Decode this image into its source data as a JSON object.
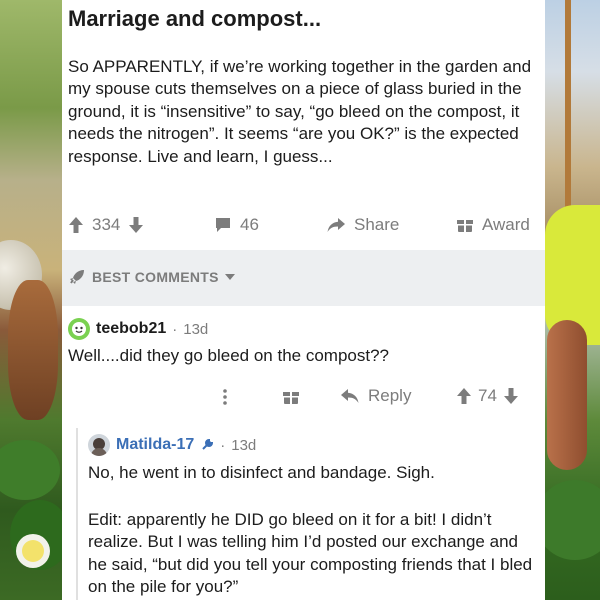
{
  "post": {
    "title": "Marriage and compost...",
    "body": "So APPARENTLY, if we’re working together in the garden and my spouse cuts themselves on a piece of glass buried in the ground, it is “insensitive” to say, “go bleed on the compost, it needs the nitrogen”.  It seems “are you OK?” is the expected response.  Live and learn, I guess...",
    "upvotes": "334",
    "comments": "46",
    "share_label": "Share",
    "award_label": "Award"
  },
  "sort": {
    "label": "BEST COMMENTS"
  },
  "comment1": {
    "author": "teebob21",
    "separator": "·",
    "age": "13d",
    "text": "Well....did they go bleed on the compost??",
    "reply_label": "Reply",
    "score": "74"
  },
  "comment2": {
    "author": "Matilda-17",
    "separator": "·",
    "age": "13d",
    "text": "No, he went in to disinfect and bandage. Sigh.",
    "edit": "Edit: apparently he DID go bleed on it for a bit! I didn’t realize. But I was telling him I’d posted our exchange and he said, “but did you tell your composting friends that I bled on the pile for you?”"
  },
  "colors": {
    "text": "#1c1c1c",
    "muted": "#7c7c7c",
    "divider": "#edeff1",
    "username_accent": "#3b6fb6",
    "avatar_green": "#7ad151"
  },
  "icons": {
    "upvote": "arrow-up-icon",
    "downvote": "arrow-down-icon",
    "comments": "comment-bubble-icon",
    "share": "share-arrow-icon",
    "award": "gift-icon",
    "sort": "rocket-icon",
    "more": "more-vertical-icon",
    "reply": "reply-arrow-icon",
    "tool": "wrench-icon"
  }
}
